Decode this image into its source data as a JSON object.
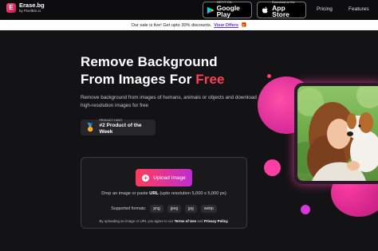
{
  "brand": {
    "logo_glyph": "E",
    "name": "Erase.bg",
    "by": "by PixelBin.io"
  },
  "nav": {
    "google_play": {
      "small": "GET IT ON",
      "big": "Google Play",
      "icon": "google-play-icon"
    },
    "app_store": {
      "small": "Download on the",
      "big": "App Store",
      "icon": "apple-icon"
    },
    "pricing": "Pricing",
    "features": "Features"
  },
  "promo": {
    "text": "Our sale is live! Get upto 30% discounts.",
    "link": "View Offers",
    "icon": "🎁"
  },
  "hero": {
    "title_line1": "Remove Background",
    "title_line2_prefix": "From Images For ",
    "title_free": "Free",
    "description": "Remove background from images of humans, animals or objects and download high-resolution images for free",
    "award_small": "PRODUCT HUNT",
    "award_big": "#2 Product of the Week",
    "award_icon": "🏅"
  },
  "upload": {
    "button_icon": "+",
    "button_label": "Upload Image",
    "drop_prefix": "Drop an image or paste ",
    "drop_url": "URL",
    "drop_suffix": " (upto resolution 5,000 x 5,000 px)",
    "formats_label": "Supported formats:",
    "formats": [
      "png",
      "jpeg",
      "jpg",
      "webp"
    ],
    "terms_prefix": "By uploading an image or URL you agree to our ",
    "terms_link": "Terms of Use",
    "terms_mid": " and ",
    "privacy_link": "Privacy Policy."
  },
  "colors": {
    "accent": "#ff3d5a",
    "accent_pink": "#ff3ea5",
    "background": "#131315",
    "link_purple": "#6b2fd6"
  }
}
